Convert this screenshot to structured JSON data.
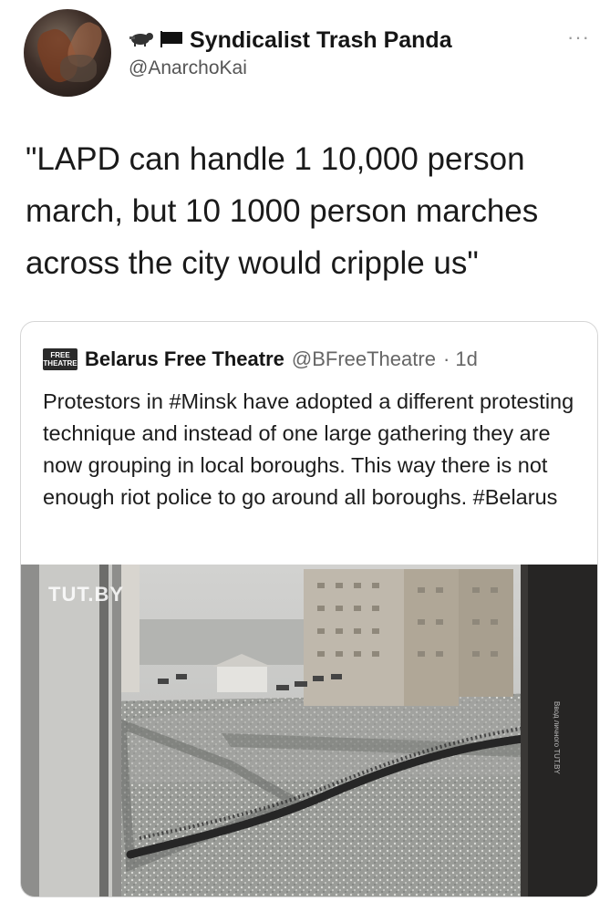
{
  "tweet": {
    "display_name": "Syndicalist Trash Panda",
    "handle": "@AnarchoKai",
    "more_label": "···",
    "text": "\"LAPD can handle 1 10,000 person march, but 10 1000 person marches across the city would cripple us\""
  },
  "quoted_tweet": {
    "logo_text": "FREE THEATRE",
    "display_name": "Belarus Free Theatre",
    "handle": "@BFreeTheatre",
    "time": "· 1d",
    "text": "Protestors in #Minsk have adopted a different protesting technique and instead of one large gathering they are now grouping in local boroughs. This way there is not enough riot police to go around all boroughs. #Belarus",
    "photo": {
      "watermark": "TUT.BY",
      "side_caption": "Ввод личного TUT.BY",
      "description_icon": "aerial-photo-crowd-in-snow"
    }
  },
  "colors": {
    "text": "#141414",
    "secondary_text": "#555555",
    "border": "#d6d6d6"
  }
}
